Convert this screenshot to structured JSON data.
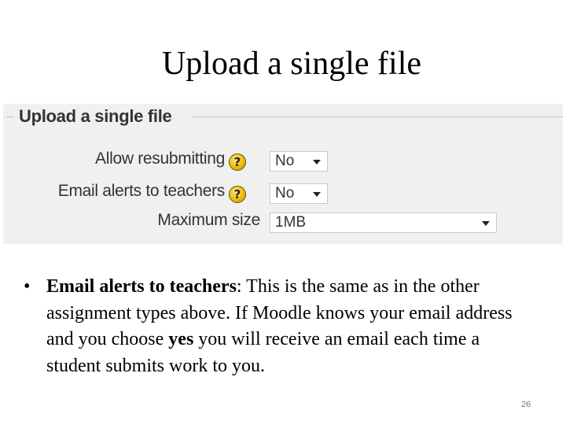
{
  "slide": {
    "title": "Upload a single file",
    "page_number": "26"
  },
  "screenshot": {
    "legend": "Upload a single file",
    "rows": [
      {
        "label": "Allow resubmitting",
        "help_icon": "help-question-icon",
        "value": "No"
      },
      {
        "label": "Email alerts to teachers",
        "help_icon": "help-question-icon",
        "value": "No"
      },
      {
        "label": "Maximum size",
        "value": "1MB"
      }
    ],
    "help_glyph": "?"
  },
  "bullet": {
    "marker": "•",
    "term": "Email alerts to teachers",
    "text_1": ": This is the same as in the other assignment types above. If Moodle knows your email address and you choose ",
    "emphasis": "yes",
    "text_2": " you will receive an email each time a student submits work to you."
  },
  "colors": {
    "panel_bg": "#f0f0f0",
    "label_text": "#333333",
    "help_icon": "#e8b800"
  }
}
